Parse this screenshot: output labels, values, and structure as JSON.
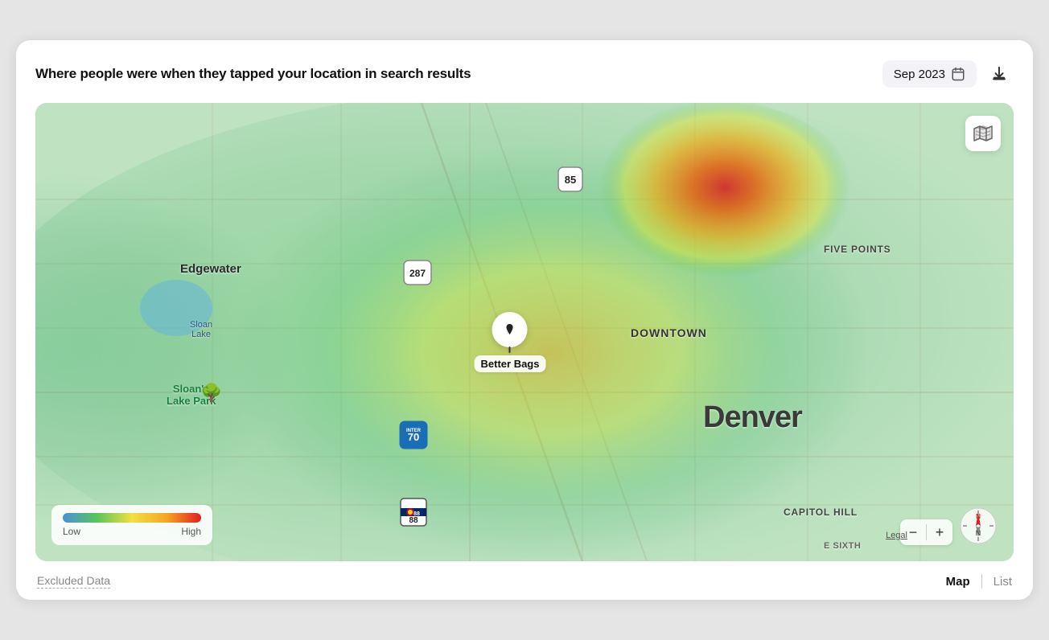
{
  "header": {
    "title": "Where people were when they tapped your location in search results",
    "date_label": "Sep 2023",
    "calendar_icon": "calendar-icon",
    "download_icon": "download-icon"
  },
  "map": {
    "location_name": "Better Bags",
    "map_icon": "map-layers-icon",
    "labels": {
      "edgewater": "Edgewater",
      "sloan_lake": "Sloan\nLake",
      "sloans_lake_park": "Sloan's\nLake Park",
      "downtown": "DOWNTOWN",
      "five_points": "FIVE POINTS",
      "denver": "Denver",
      "capitol_hill": "CAPITOL HILL",
      "e_sixth": "E SIXTH"
    },
    "highways": {
      "us85": "85",
      "us287": "287",
      "i70": "70",
      "co88": "88"
    },
    "legal_link": "Legal",
    "compass": {
      "north": "N"
    }
  },
  "legend": {
    "low_label": "Low",
    "high_label": "High"
  },
  "footer": {
    "excluded_data_label": "Excluded Data",
    "view_map_label": "Map",
    "view_list_label": "List"
  },
  "zoom": {
    "minus": "−",
    "plus": "+"
  }
}
